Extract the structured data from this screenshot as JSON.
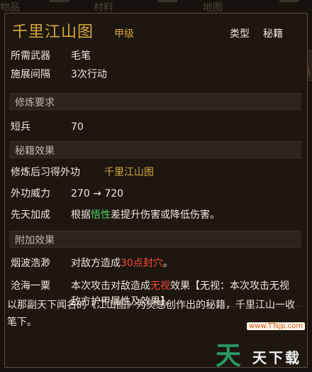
{
  "background_tabs": [
    "物品",
    "材料",
    "地图"
  ],
  "item": {
    "name": "千里江山图",
    "grade": "甲级",
    "type_label": "类型",
    "type_value": "秘籍"
  },
  "stats": [
    {
      "label": "所需武器",
      "value": "毛笔"
    },
    {
      "label": "施展间隔",
      "value": "3次行动"
    }
  ],
  "requirements_section": "修炼要求",
  "requirements": [
    {
      "label": "短兵",
      "value": "70"
    }
  ],
  "manual_section": "秘籍效果",
  "manual": {
    "learn_label": "修炼后习得外功",
    "learn_value": "千里江山图",
    "power_label": "外功威力",
    "power_value": "270 → 720",
    "attr_label": "先天加成",
    "attr_prefix": "根据",
    "attr_highlight": "悟性",
    "attr_suffix": "差提升伤害或降低伤害。"
  },
  "extra_section": "附加效果",
  "extra": {
    "effect1_label": "烟波浩渺",
    "effect1_prefix": "对敌方造成",
    "effect1_highlight": "30点封穴",
    "effect1_suffix": "。",
    "effect2_label": "沧海一粟",
    "effect2_prefix": "本次攻击对敌造成",
    "effect2_highlight": "无视",
    "effect2_suffix": "效果【无视：本次攻击无视敌方护甲属性及效果】。"
  },
  "description": "以那副天下闻名的《江山图》为灵感创作出的秘籍，千里江山一收笔下。",
  "watermark": {
    "url": "www.TTsjp.com",
    "big": "天",
    "small": "天下载"
  },
  "colors": {
    "title_gold": "#d8a53f",
    "highlight_green": "#53d36b",
    "highlight_red": "#ff4a3a"
  }
}
